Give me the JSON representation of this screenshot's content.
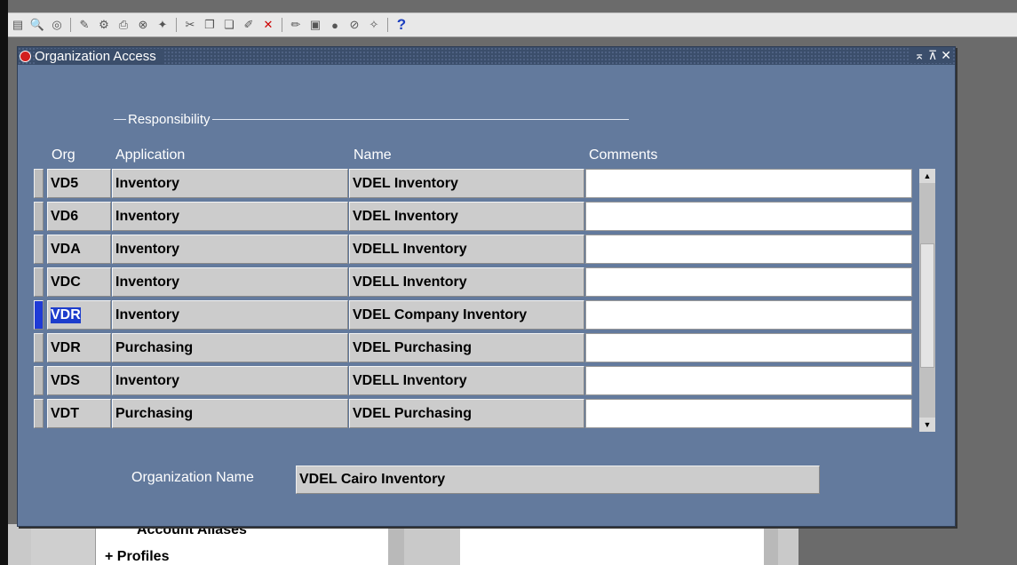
{
  "window": {
    "title": "Organization Access",
    "controls": [
      "minimize",
      "maximize",
      "close"
    ]
  },
  "toolbar": {
    "icons": [
      "new-icon",
      "find-icon",
      "navigator-icon",
      "open-icon",
      "save-icon",
      "print-icon",
      "close-form-icon",
      "cut-icon",
      "copy-icon",
      "paste-icon",
      "clear-record-icon",
      "delete-icon",
      "edit-field-icon",
      "zoom-icon",
      "translations-icon",
      "attachments-icon",
      "folder-tools-icon",
      "help-icon"
    ],
    "help_label": "?"
  },
  "group": {
    "label": "Responsibility"
  },
  "columns": {
    "org": "Org",
    "application": "Application",
    "name": "Name",
    "comments": "Comments"
  },
  "rows": [
    {
      "org": "VD5",
      "application": "Inventory",
      "name": "VDEL Inventory",
      "comments": "",
      "active": false
    },
    {
      "org": "VD6",
      "application": "Inventory",
      "name": "VDEL Inventory",
      "comments": "",
      "active": false
    },
    {
      "org": "VDA",
      "application": "Inventory",
      "name": "VDELL Inventory",
      "comments": "",
      "active": false
    },
    {
      "org": "VDC",
      "application": "Inventory",
      "name": "VDELL Inventory",
      "comments": "",
      "active": false
    },
    {
      "org": "VDR",
      "application": "Inventory",
      "name": "VDEL Company Inventory",
      "comments": "",
      "active": true
    },
    {
      "org": "VDR",
      "application": "Purchasing",
      "name": "VDEL Purchasing",
      "comments": "",
      "active": false
    },
    {
      "org": "VDS",
      "application": "Inventory",
      "name": "VDELL Inventory",
      "comments": "",
      "active": false
    },
    {
      "org": "VDT",
      "application": "Purchasing",
      "name": "VDEL Purchasing",
      "comments": "",
      "active": false
    }
  ],
  "organization_name": {
    "label": "Organization Name",
    "value": "VDEL Cairo Inventory"
  },
  "background": {
    "item1": "Account Aliases",
    "item2": "+  Profiles"
  },
  "colors": {
    "window_bg": "#637a9d",
    "titlebar": "#3b4e6b",
    "selection": "#1d3dcc",
    "field": "#cccccc"
  }
}
